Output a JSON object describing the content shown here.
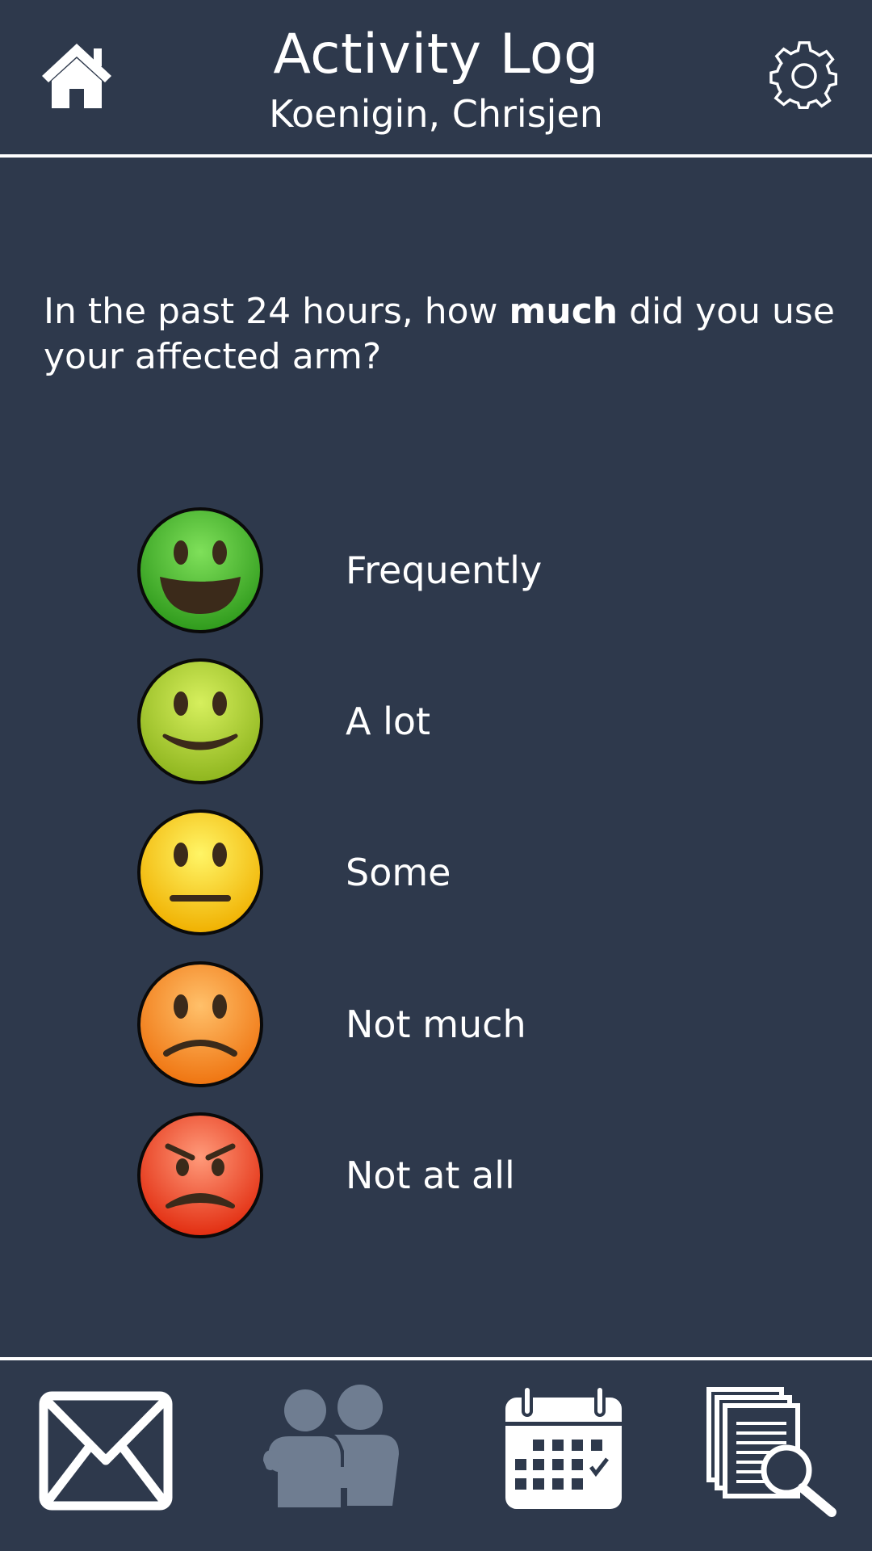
{
  "header": {
    "title": "Activity Log",
    "subtitle": "Koenigin, Chrisjen",
    "home_icon": "home-icon",
    "settings_icon": "gear-icon"
  },
  "question": {
    "prefix": "In the past 24 hours, how ",
    "emphasis": "much",
    "suffix": " did you use your affected arm?"
  },
  "options": [
    {
      "label": "Frequently",
      "icon": "very-happy-face-icon",
      "color": "#3aa821"
    },
    {
      "label": "A lot",
      "icon": "smiling-face-icon",
      "color": "#9cc422"
    },
    {
      "label": "Some",
      "icon": "neutral-face-icon",
      "color": "#f1d20a"
    },
    {
      "label": "Not much",
      "icon": "frowning-face-icon",
      "color": "#f2891f"
    },
    {
      "label": "Not at all",
      "icon": "angry-face-icon",
      "color": "#ea3518"
    }
  ],
  "footer": {
    "items": [
      {
        "icon": "mail-icon"
      },
      {
        "icon": "people-icon"
      },
      {
        "icon": "calendar-icon"
      },
      {
        "icon": "documents-search-icon"
      }
    ]
  },
  "colors": {
    "background": "#2e394c",
    "foreground": "#ffffff",
    "disabled_icon": "#6f7d91"
  }
}
